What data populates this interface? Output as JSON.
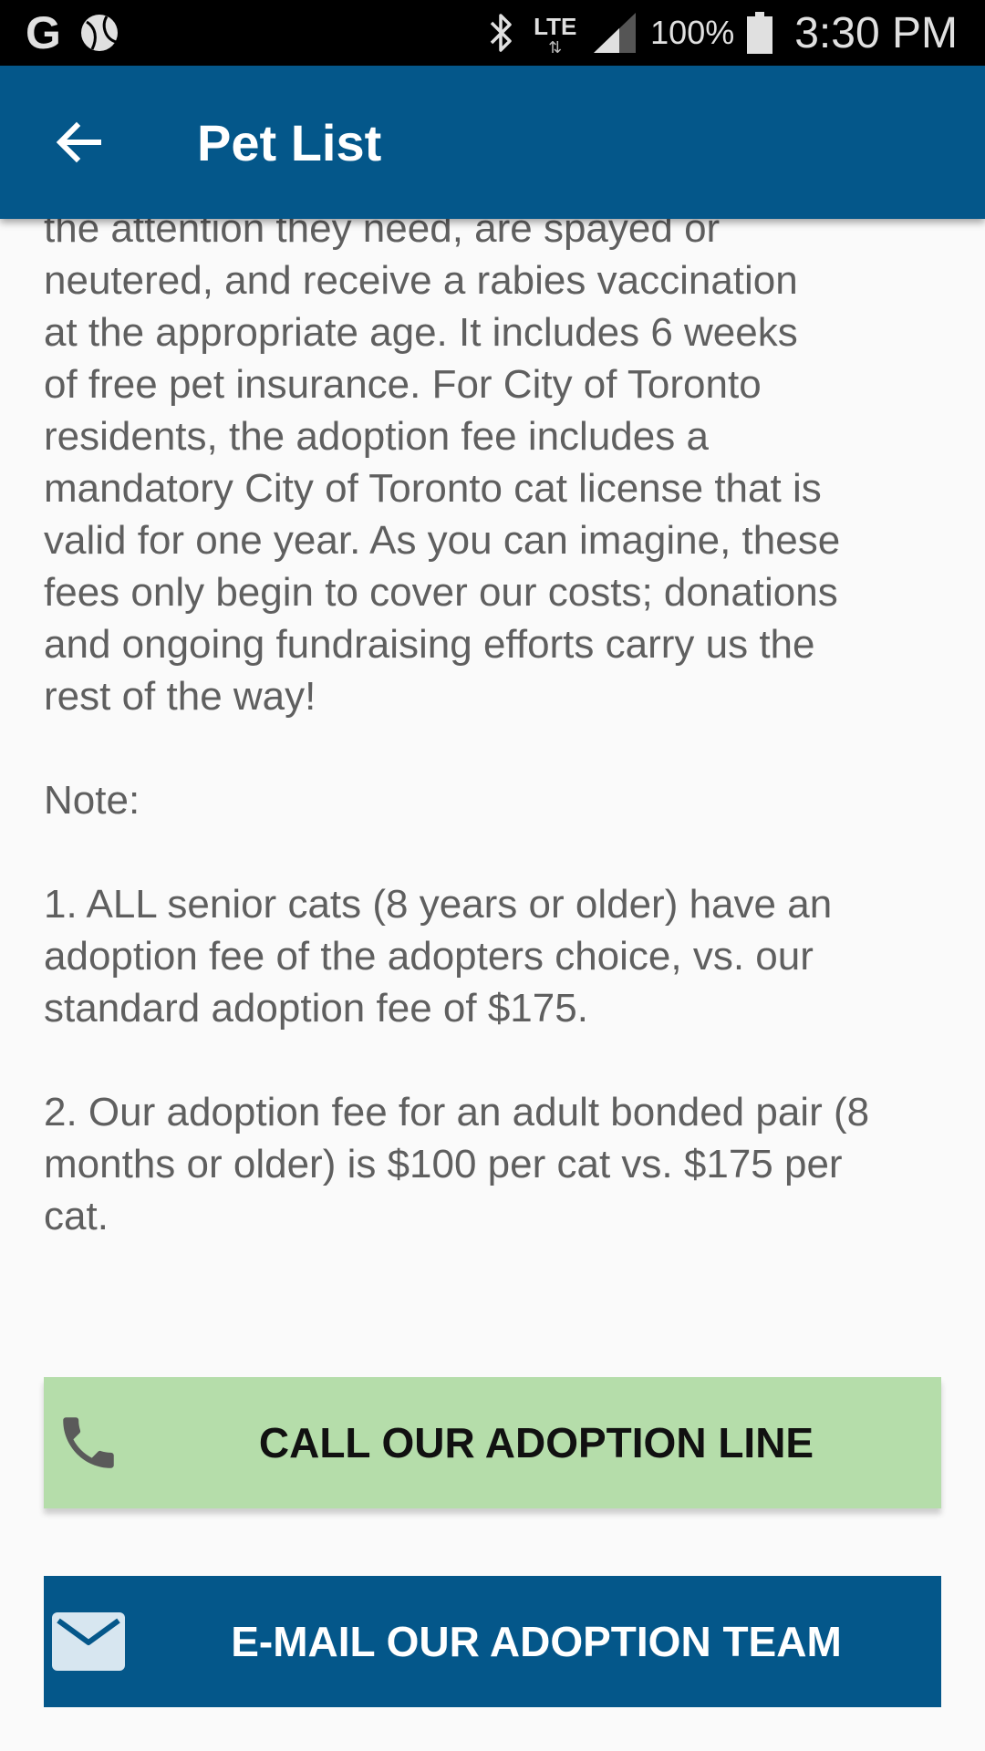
{
  "status_bar": {
    "left_icons": [
      "google-icon",
      "ball-icon"
    ],
    "google_letter": "G",
    "network": "LTE",
    "network_arrows": "⇅",
    "battery_percent": "100%",
    "time": "3:30 PM",
    "icons": [
      "bluetooth-icon",
      "signal-icon",
      "battery-icon"
    ]
  },
  "app_bar": {
    "title": "Pet List",
    "back_icon": "arrow-back-icon"
  },
  "content": {
    "body_text": "the attention they need, are spayed or\nneutered, and receive a rabies vaccination\nat the appropriate age. It includes 6 weeks\nof free pet insurance. For City of Toronto\nresidents, the adoption fee includes a\nmandatory City of Toronto cat license that is\nvalid for one year. As you can imagine, these\nfees only begin to cover our costs; donations\nand ongoing fundraising efforts carry us the\nrest of the way!\n\nNote:\n\n1. ALL senior cats (8 years or older) have an\nadoption fee of the adopters choice, vs. our\nstandard adoption fee of $175.\n\n2. Our adoption fee for an adult bonded pair (8\nmonths or older) is $100 per cat vs. $175 per\ncat."
  },
  "actions": {
    "call_label": "CALL OUR ADOPTION LINE",
    "call_icon": "phone-icon",
    "email_label": "E-MAIL OUR ADOPTION TEAM",
    "email_icon": "mail-icon"
  },
  "colors": {
    "status_bar_bg": "#000000",
    "app_bar_bg": "#04578a",
    "call_button_bg": "#b5ddaa",
    "email_button_bg": "#04578a",
    "body_text": "#5f5f5f",
    "page_bg": "#fafafa"
  }
}
